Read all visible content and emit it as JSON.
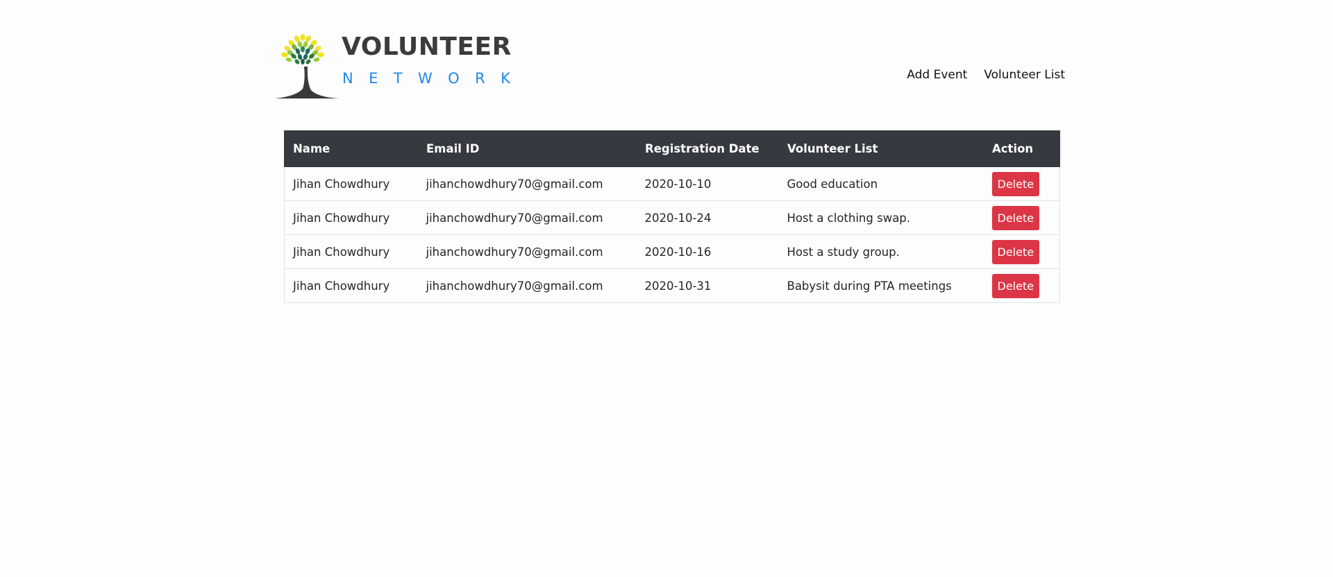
{
  "brand": {
    "word_top": "VOLUNTEER",
    "word_bottom": "NETWORK",
    "colors": {
      "dark": "#3b3b3b",
      "blue": "#1e87e8",
      "trunk": "#3a3a3a",
      "leaf_yellow": "#f4e21a",
      "leaf_green": "#7cb342",
      "leaf_teal": "#1e6b5c"
    }
  },
  "nav": {
    "add_event": "Add Event",
    "volunteer_list": "Volunteer List"
  },
  "table": {
    "headers": {
      "name": "Name",
      "email": "Email ID",
      "date": "Registration Date",
      "list": "Volunteer List",
      "action": "Action"
    },
    "rows": [
      {
        "name": "Jihan Chowdhury",
        "email": "jihanchowdhury70@gmail.com",
        "date": "2020-10-10",
        "list": "Good education",
        "action": "Delete"
      },
      {
        "name": "Jihan Chowdhury",
        "email": "jihanchowdhury70@gmail.com",
        "date": "2020-10-24",
        "list": "Host a clothing swap.",
        "action": "Delete"
      },
      {
        "name": "Jihan Chowdhury",
        "email": "jihanchowdhury70@gmail.com",
        "date": "2020-10-16",
        "list": "Host a study group.",
        "action": "Delete"
      },
      {
        "name": "Jihan Chowdhury",
        "email": "jihanchowdhury70@gmail.com",
        "date": "2020-10-31",
        "list": "Babysit during PTA meetings",
        "action": "Delete"
      }
    ],
    "colors": {
      "header_bg": "#343a40",
      "delete_bg": "#dc3545"
    }
  }
}
